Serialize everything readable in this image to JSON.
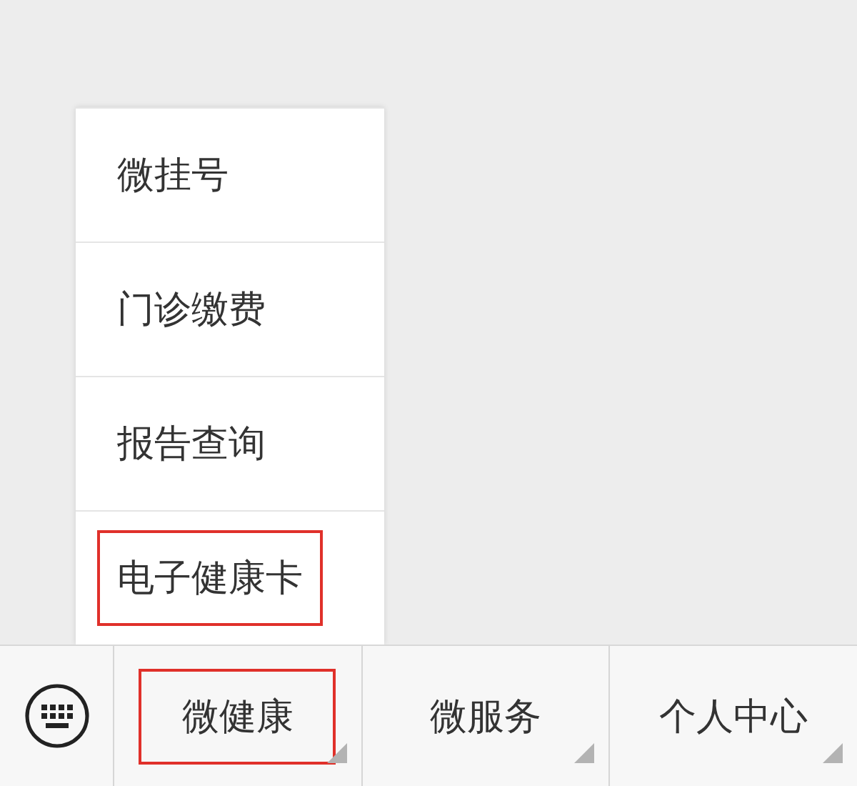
{
  "submenu": {
    "items": [
      {
        "label": "微挂号",
        "highlighted": false
      },
      {
        "label": "门诊缴费",
        "highlighted": false
      },
      {
        "label": "报告查询",
        "highlighted": false
      },
      {
        "label": "电子健康卡",
        "highlighted": true
      }
    ]
  },
  "menu_bar": {
    "tabs": [
      {
        "label": "微健康",
        "highlighted": true
      },
      {
        "label": "微服务",
        "highlighted": false
      },
      {
        "label": "个人中心",
        "highlighted": false
      }
    ]
  }
}
